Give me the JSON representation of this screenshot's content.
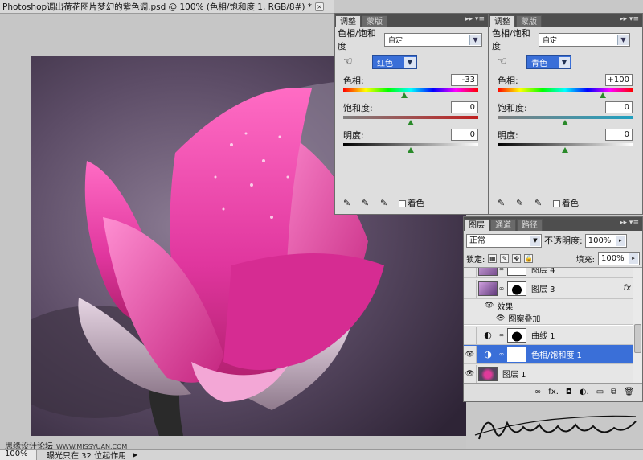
{
  "document": {
    "tab_title": "Photoshop调出荷花图片梦幻的紫色调.psd @ 100% (色相/饱和度 1, RGB/8#) *",
    "close_label": "×"
  },
  "status_bar": {
    "zoom": "100%",
    "message": "曝光只在 32 位起作用",
    "arrow": "▶"
  },
  "watermark": {
    "site": "思缘设计论坛",
    "url": "WWW.MISSYUAN.COM",
    "signature": "Huoshanrizuo"
  },
  "adjust_panels": [
    {
      "tabs": [
        "调整",
        "蒙版"
      ],
      "controls": "▸▸ ▾≡",
      "preset_label": "色相/饱和度",
      "preset_value": "自定",
      "channel": "红色",
      "hue_label": "色相:",
      "hue_value": "-33",
      "hue_level": 0.454,
      "sat_label": "饱和度:",
      "sat_value": "0",
      "sat_level": 0.5,
      "light_label": "明度:",
      "light_value": "0",
      "light_level": 0.5,
      "colorize_label": "着色"
    },
    {
      "tabs": [
        "调整",
        "蒙版"
      ],
      "controls": "▸▸ ▾≡",
      "preset_label": "色相/饱和度",
      "preset_value": "自定",
      "channel": "青色",
      "hue_label": "色相:",
      "hue_value": "+100",
      "hue_level": 0.778,
      "sat_label": "饱和度:",
      "sat_value": "0",
      "sat_level": 0.5,
      "light_label": "明度:",
      "light_value": "0",
      "light_level": 0.5,
      "colorize_label": "着色"
    }
  ],
  "layers_panel": {
    "tabs": [
      "图层",
      "通道",
      "路径"
    ],
    "controls": "▸▸ ▾≡",
    "blend_mode": "正常",
    "opacity_label": "不透明度:",
    "opacity_value": "100%",
    "lock_label": "锁定:",
    "fill_label": "填充:",
    "fill_value": "100%",
    "layers": [
      {
        "name": "图层 4",
        "fx": ""
      },
      {
        "name": "图层 3",
        "fx": "fx"
      },
      {
        "name": "效果",
        "fx": ""
      },
      {
        "name": "图案叠加",
        "fx": ""
      },
      {
        "name": "曲线 1",
        "fx": ""
      },
      {
        "name": "色相/饱和度 1",
        "fx": ""
      },
      {
        "name": "图层 1",
        "fx": ""
      }
    ],
    "footer_icons": [
      "link-icon",
      "fx-icon",
      "mask-icon",
      "adjustment-icon",
      "group-icon",
      "new-layer-icon",
      "trash-icon"
    ],
    "footer_glyphs": [
      "∞",
      "fx.",
      "◘",
      "◐.",
      "▭",
      "⧉",
      "🗑"
    ]
  }
}
